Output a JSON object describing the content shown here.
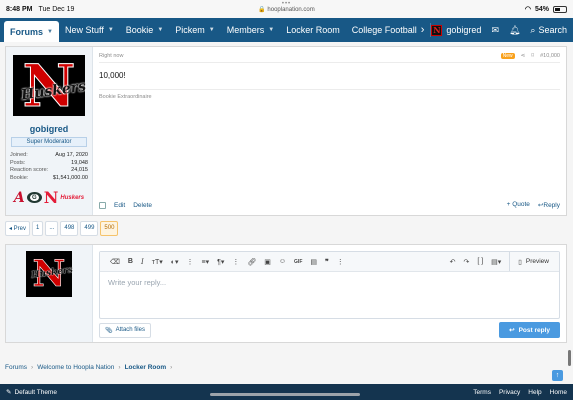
{
  "status_bar": {
    "time": "8:48 PM",
    "date": "Tue Dec 19",
    "url": "hooplanation.com",
    "battery": "54%",
    "battery_level": 0.54
  },
  "nav": {
    "tabs": [
      {
        "label": "Forums"
      },
      {
        "label": "New Stuff"
      },
      {
        "label": "Bookie"
      },
      {
        "label": "Pickem"
      },
      {
        "label": "Members"
      },
      {
        "label": "Locker Room"
      },
      {
        "label": "College Football"
      }
    ],
    "username": "gobigred",
    "search_label": "Search"
  },
  "post": {
    "time": "Right now",
    "new_badge": "New",
    "post_number": "#10,000",
    "message": "10,000!",
    "signature": "Bookie Extraordinaire",
    "actions": {
      "edit": "Edit",
      "delete": "Delete",
      "quote": "+ Quote",
      "reply": "Reply"
    },
    "author": {
      "username": "gobigred",
      "role": "Super Moderator",
      "stats": [
        {
          "label": "Joined:",
          "value": "Aug 17, 2020"
        },
        {
          "label": "Posts:",
          "value": "19,048"
        },
        {
          "label": "Reaction score:",
          "value": "24,015"
        },
        {
          "label": "Bookie:",
          "value": "$1,541,000.00"
        }
      ]
    }
  },
  "pagination": {
    "prev": "◂ Prev",
    "pages": [
      "1",
      "...",
      "498",
      "499",
      "500"
    ],
    "current": "500"
  },
  "reply": {
    "placeholder": "Write your reply...",
    "preview": "Preview",
    "attach": "Attach files",
    "submit": "Post reply"
  },
  "breadcrumb": [
    "Forums",
    "Welcome to Hoopla Nation",
    "Locker Room"
  ],
  "footer": {
    "theme": "Default Theme",
    "links": [
      "Terms",
      "Privacy",
      "Help",
      "Home"
    ]
  },
  "colors": {
    "nav_bg": "#185886",
    "footer_bg": "#14344f",
    "accent": "#4a9ae0",
    "new_badge": "#f9a11b"
  }
}
